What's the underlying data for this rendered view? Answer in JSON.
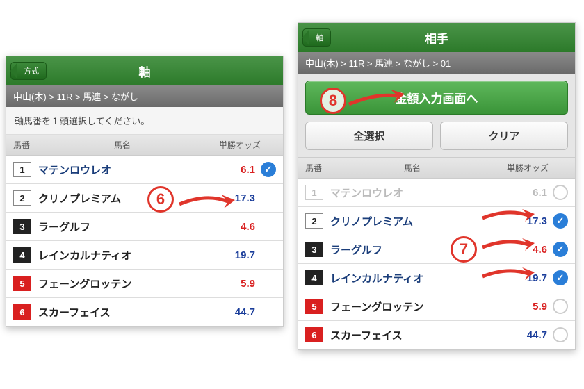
{
  "left": {
    "back_label": "方式",
    "title": "軸",
    "breadcrumb": "中山(木) > 11R > 馬連 > ながし",
    "instruction": "軸馬番を１頭選択してください。",
    "cols": {
      "num": "馬番",
      "name": "馬名",
      "odds": "単勝オッズ"
    },
    "rows": [
      {
        "num": "1",
        "style": "white",
        "name": "マテンロウレオ",
        "odds": "6.1",
        "odds_cls": "low",
        "selected": true,
        "has_check": true
      },
      {
        "num": "2",
        "style": "white",
        "name": "クリノプレミアム",
        "odds": "17.3",
        "odds_cls": "high"
      },
      {
        "num": "3",
        "style": "black",
        "name": "ラーグルフ",
        "odds": "4.6",
        "odds_cls": "low"
      },
      {
        "num": "4",
        "style": "black",
        "name": "レインカルナティオ",
        "odds": "19.7",
        "odds_cls": "high"
      },
      {
        "num": "5",
        "style": "red",
        "name": "フェーングロッテン",
        "odds": "5.9",
        "odds_cls": "low"
      },
      {
        "num": "6",
        "style": "red",
        "name": "スカーフェイス",
        "odds": "44.7",
        "odds_cls": "high"
      }
    ]
  },
  "right": {
    "back_label": "軸",
    "title": "相手",
    "breadcrumb": "中山(木) > 11R > 馬連 > ながし > 01",
    "primary_btn": "金額入力画面へ",
    "select_all": "全選択",
    "clear": "クリア",
    "cols": {
      "num": "馬番",
      "name": "馬名",
      "odds": "単勝オッズ"
    },
    "rows": [
      {
        "num": "1",
        "style": "white",
        "name": "マテンロウレオ",
        "odds": "6.1",
        "disabled": true
      },
      {
        "num": "2",
        "style": "white",
        "name": "クリノプレミアム",
        "odds": "17.3",
        "odds_cls": "high",
        "selected": true
      },
      {
        "num": "3",
        "style": "black",
        "name": "ラーグルフ",
        "odds": "4.6",
        "odds_cls": "low",
        "selected": true
      },
      {
        "num": "4",
        "style": "black",
        "name": "レインカルナティオ",
        "odds": "19.7",
        "odds_cls": "high",
        "selected": true
      },
      {
        "num": "5",
        "style": "red",
        "name": "フェーングロッテン",
        "odds": "5.9",
        "odds_cls": "low"
      },
      {
        "num": "6",
        "style": "red",
        "name": "スカーフェイス",
        "odds": "44.7",
        "odds_cls": "high"
      }
    ]
  },
  "annotations": {
    "a6": "6",
    "a7": "7",
    "a8": "8"
  }
}
